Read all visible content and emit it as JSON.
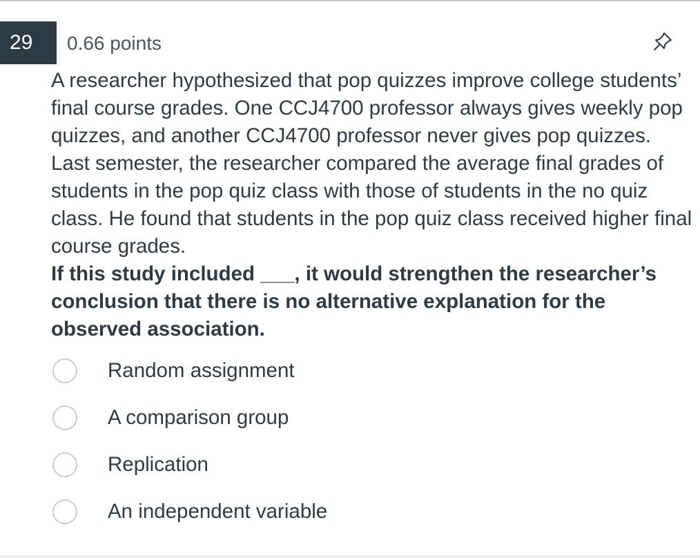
{
  "question": {
    "number": "29",
    "points": "0.66 points",
    "pin_icon": "pin-icon",
    "stem": "A researcher hypothesized that pop quizzes improve college students’ final course grades. One CCJ4700 professor always gives weekly pop quizzes, and another CCJ4700 professor never gives pop quizzes. Last semester, the researcher compared the average final grades of students in the pop quiz class with those of students in the no quiz class. He found that students in the pop quiz class received higher final course grades.",
    "prompt": "If this study included ___, it would strengthen the researcher’s conclusion that there is no alternative explanation for the observed association."
  },
  "answers": [
    {
      "label": "Random assignment",
      "selected": false
    },
    {
      "label": "A comparison group",
      "selected": false
    },
    {
      "label": "Replication",
      "selected": false
    },
    {
      "label": "An independent variable",
      "selected": false
    }
  ],
  "colors": {
    "header_bg": "#2d3b45",
    "text": "#2d3b45",
    "radio_border": "#c7cdd1"
  }
}
